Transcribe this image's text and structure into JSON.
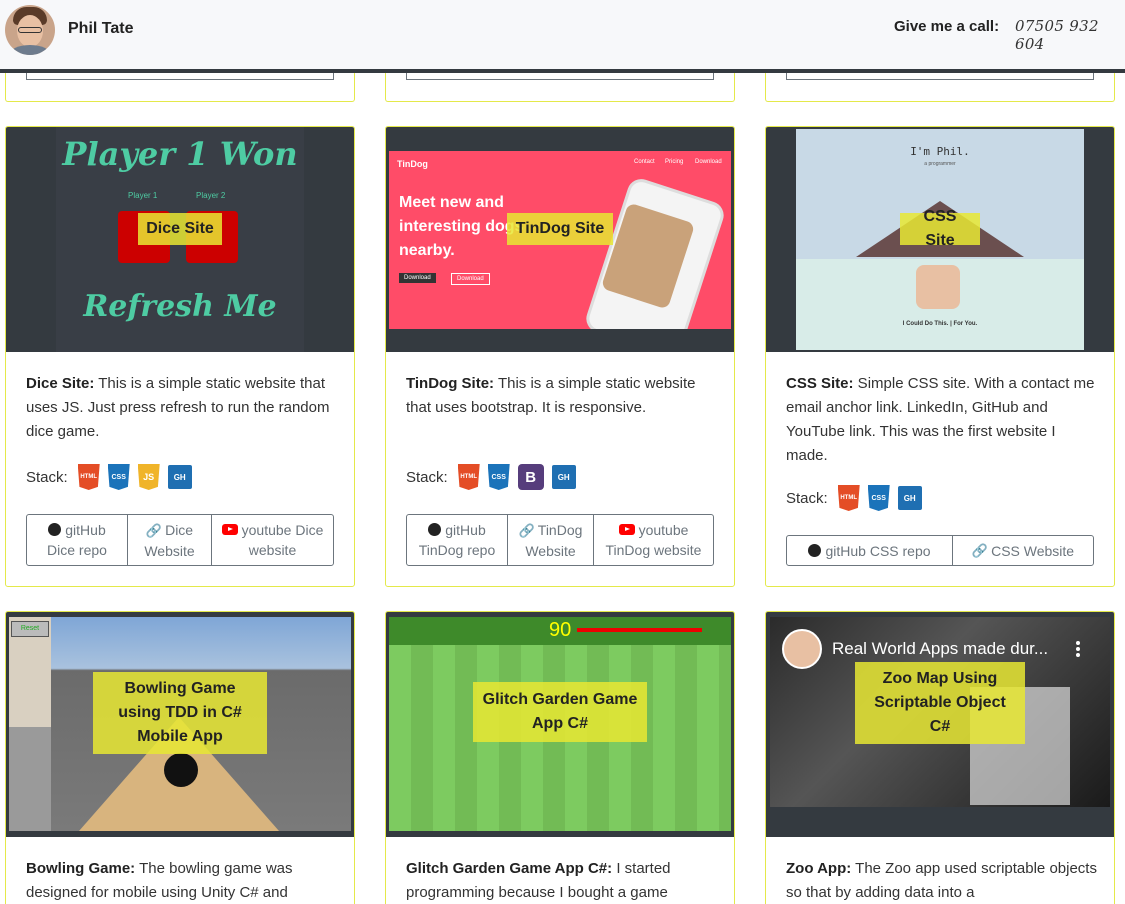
{
  "header": {
    "name": "Phil Tate",
    "call_label": "Give me a call:",
    "phone": "07505 932 604"
  },
  "cards": {
    "dice": {
      "overlay": "Dice Site",
      "shot_title": "Player 1 Won",
      "shot_p1": "Player 1",
      "shot_p2": "Player 2",
      "shot_refresh": "Refresh Me",
      "title": "Dice Site:",
      "text": " This is a simple static website that uses JS. Just press refresh to run the random dice game.",
      "stack_label": "Stack:",
      "buttons": [
        "gitHub Dice repo",
        "Dice Website",
        "youtube Dice website"
      ]
    },
    "tindog": {
      "overlay": "TinDog Site",
      "shot_brand": "TinDog",
      "shot_headline": "Meet new and interesting dogs nearby.",
      "shot_download": "Download",
      "shot_nav": [
        "Contact",
        "Pricing",
        "Download"
      ],
      "title": "TinDog Site:",
      "text": " This is a simple static website that uses bootstrap. It is responsive.",
      "stack_label": "Stack:",
      "buttons": [
        "gitHub TinDog repo",
        "TinDog Website",
        "youtube TinDog website"
      ]
    },
    "css": {
      "overlay": "CSS Site",
      "shot_heading": "I'm Phil.",
      "shot_sub": "a programmer",
      "shot_tag": "I Could Do This. | For You.",
      "title": "CSS Site:",
      "text": " Simple CSS site. With a contact me email anchor link. LinkedIn, GitHub and YouTube link. This was the first website I made.",
      "stack_label": "Stack:",
      "buttons": [
        "gitHub CSS repo",
        "CSS Website"
      ]
    },
    "bowling": {
      "overlay": "Bowling Game using TDD in C# Mobile App",
      "shot_reset": "Reset",
      "title": "Bowling Game:",
      "text": " The bowling game was designed for mobile using Unity C# and"
    },
    "glitch": {
      "overlay": "Glitch Garden Game App C#",
      "shot_score": "90",
      "title": "Glitch Garden Game App C#:",
      "text": " I started programming because I bought a game"
    },
    "zoo": {
      "overlay": "Zoo Map Using Scriptable Object C#",
      "shot_video_title": "Real World Apps made dur...",
      "title": "Zoo App:",
      "text": " The Zoo app used scriptable objects so that by adding data into a"
    }
  },
  "icons": {
    "html": "HTML",
    "css": "CSS",
    "js": "JS",
    "bootstrap": "B",
    "github": "GH"
  },
  "colors": {
    "card_border": "#e4e94a",
    "overlay": "#e8e832",
    "header_border": "#343a40",
    "youtube": "#ff0000"
  }
}
